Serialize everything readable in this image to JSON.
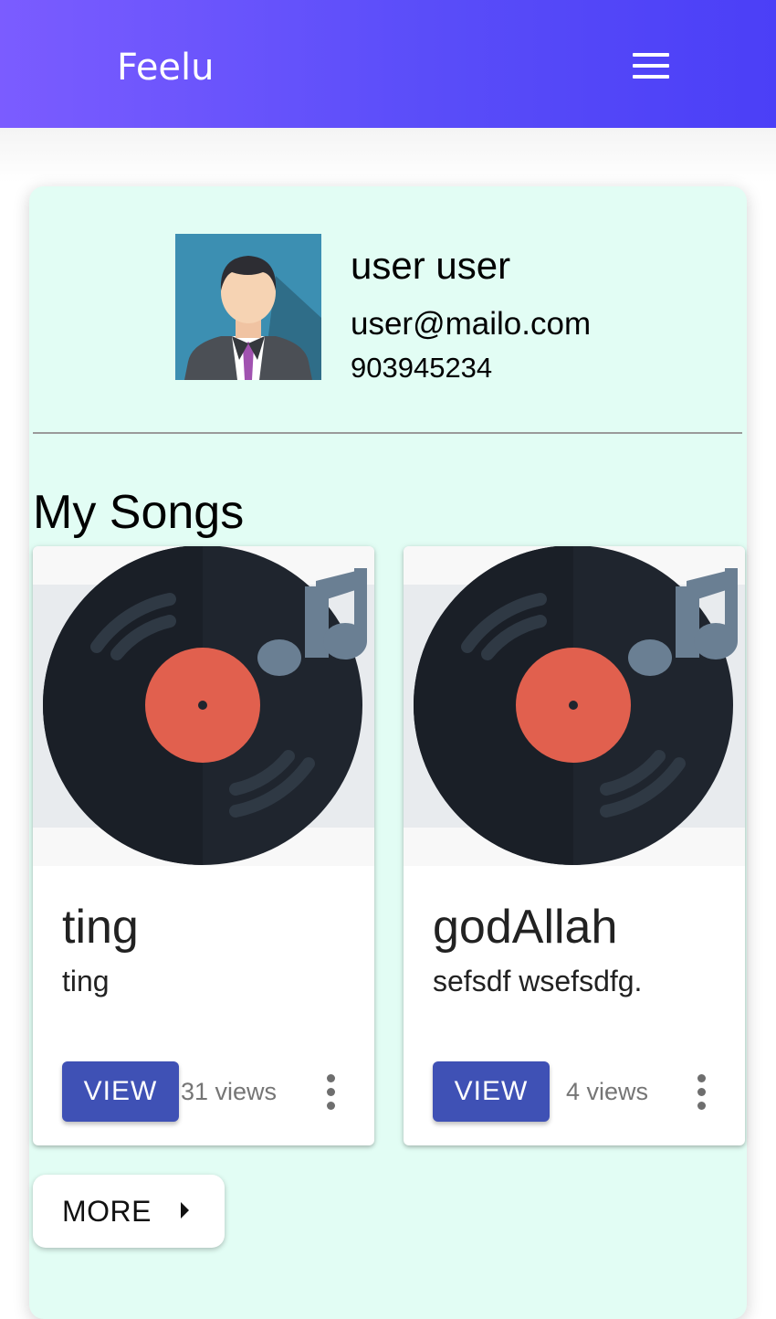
{
  "app": {
    "brand": "Feelu"
  },
  "header": {
    "menu_icon": "hamburger-menu-icon"
  },
  "profile": {
    "name": "user user",
    "email": "user@mailo.com",
    "phone": "903945234",
    "avatar_icon": "user-avatar-icon"
  },
  "songs_section": {
    "title": "My Songs"
  },
  "songs": [
    {
      "title": "ting",
      "description": "ting",
      "view_label": "VIEW",
      "views": "31 views",
      "image_icon": "vinyl-record-icon"
    },
    {
      "title": "godAllah",
      "description": "sefsdf wsefsdfg.",
      "view_label": "VIEW",
      "views": "4 views",
      "image_icon": "vinyl-record-icon"
    }
  ],
  "more_button": {
    "label": "MORE",
    "icon": "arrow-right-icon"
  },
  "colors": {
    "header_gradient_start": "#7b5cff",
    "header_gradient_end": "#4b3ff7",
    "card_background": "#e2fdf4",
    "button_primary": "#3f51b5",
    "record_label": "#e1604e",
    "record_vinyl": "#1f252e"
  }
}
